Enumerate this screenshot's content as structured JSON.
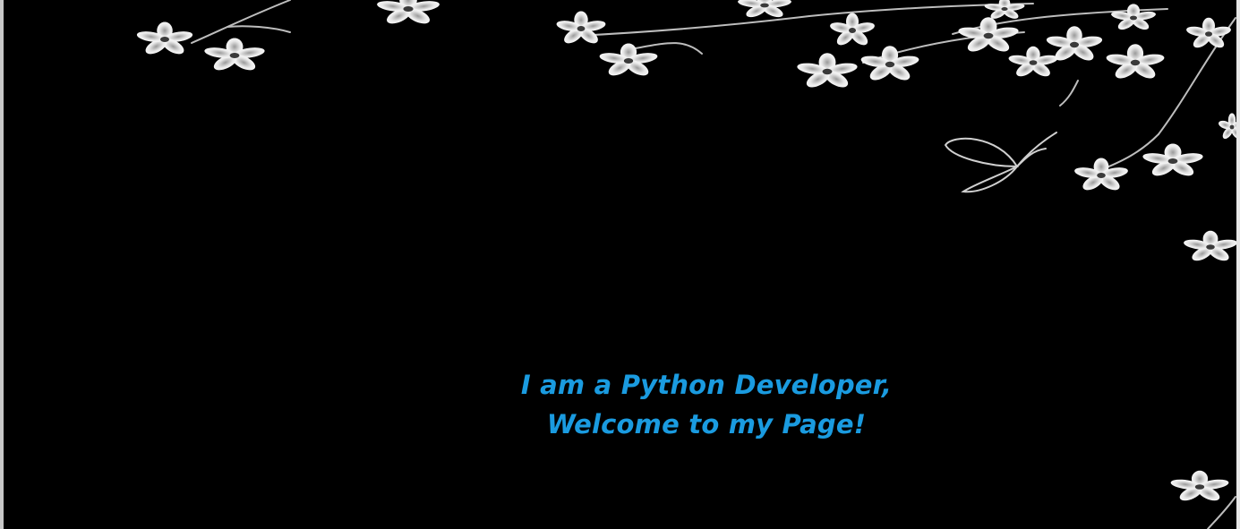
{
  "hero": {
    "line1": "I am a Python Developer,",
    "line2": "Welcome to my Page!",
    "text_color": "#1a9be0",
    "background_color": "#000000",
    "decoration": [
      "flower-branch-icon",
      "butterfly-icon"
    ]
  }
}
